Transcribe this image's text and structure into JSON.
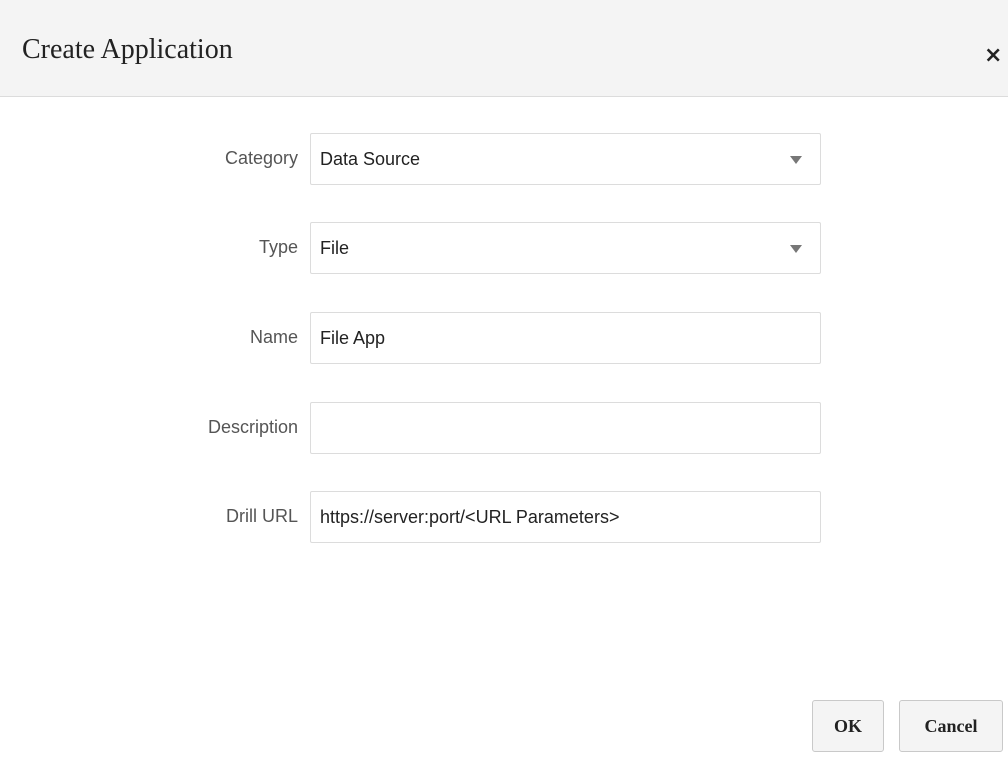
{
  "dialog": {
    "title": "Create Application",
    "close_glyph": "×"
  },
  "form": {
    "category": {
      "label": "Category",
      "value": "Data Source"
    },
    "type": {
      "label": "Type",
      "value": "File"
    },
    "name": {
      "label": "Name",
      "value": "File App"
    },
    "description": {
      "label": "Description",
      "value": ""
    },
    "drill_url": {
      "label": "Drill URL",
      "value": "https://server:port/<URL Parameters>"
    }
  },
  "buttons": {
    "ok_label": "OK",
    "cancel_label": "Cancel"
  },
  "icons": {
    "close": "close-icon",
    "dropdown": "chevron-down-icon"
  }
}
